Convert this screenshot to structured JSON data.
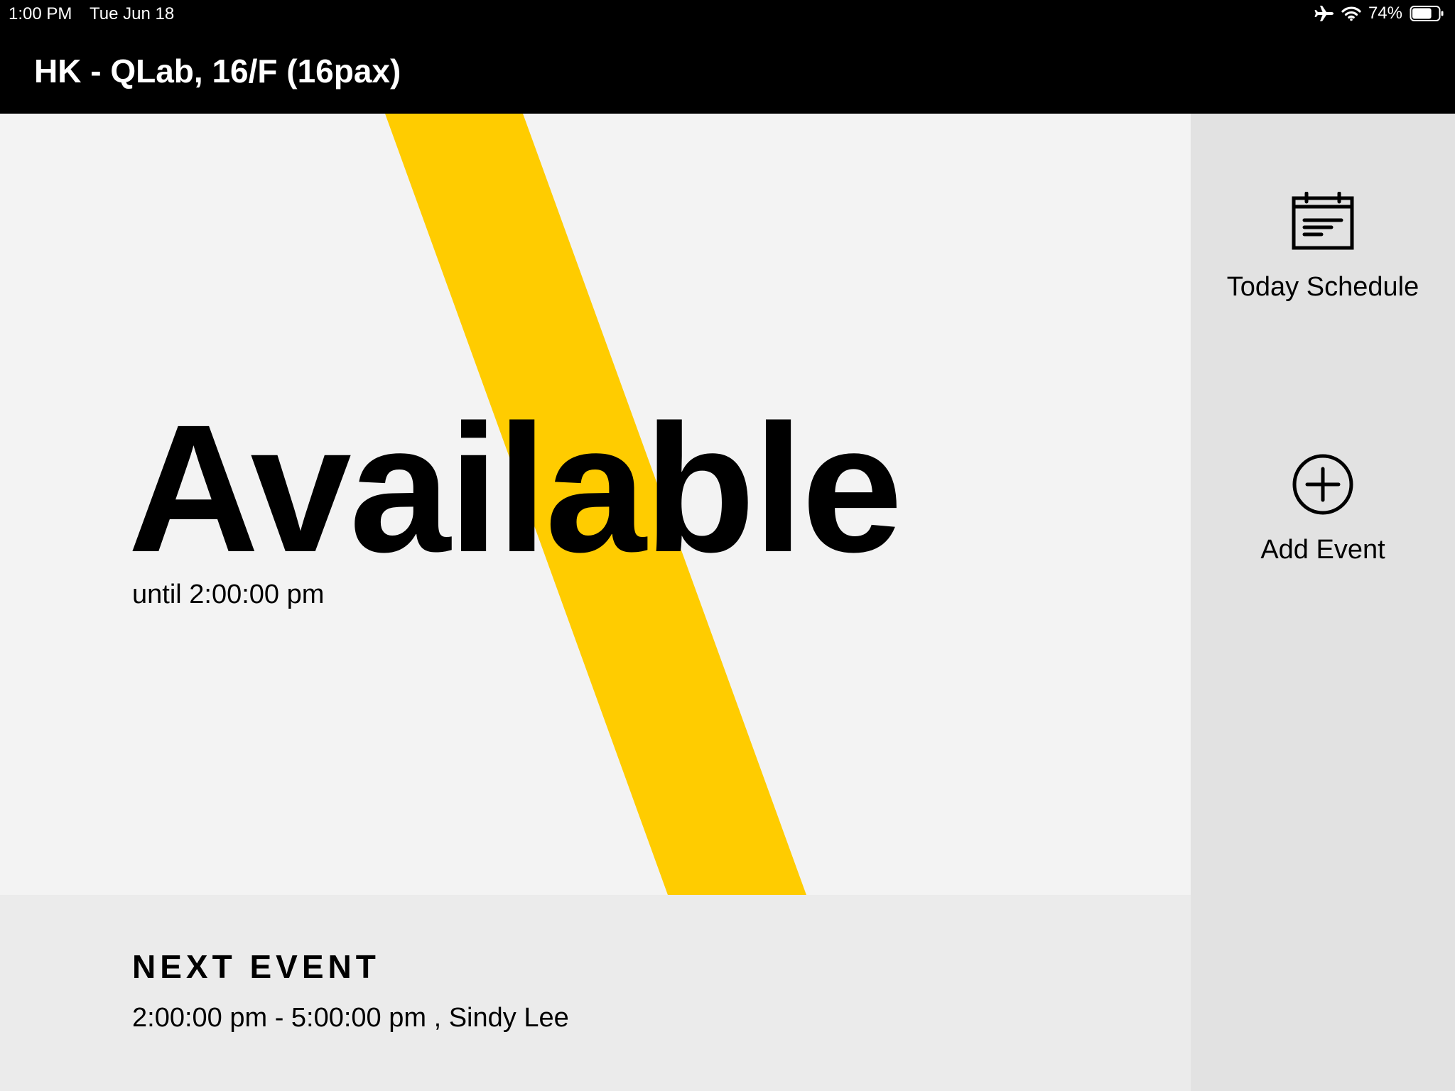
{
  "status_bar": {
    "time": "1:00 PM",
    "date": "Tue Jun 18",
    "battery_percent": "74%",
    "battery_level": 0.74,
    "icons": [
      "airplane-icon",
      "wifi-icon",
      "battery-icon"
    ]
  },
  "header": {
    "room_name": "HK - QLab, 16/F (16pax)"
  },
  "main": {
    "status": "Available",
    "until": "until 2:00:00 pm",
    "accent_color": "#ffcc00"
  },
  "next_event": {
    "heading": "NEXT EVENT",
    "detail": "2:00:00 pm - 5:00:00 pm , Sindy Lee"
  },
  "sidebar": {
    "today_schedule_label": "Today Schedule",
    "today_schedule_icon": "calendar-icon",
    "add_event_label": "Add Event",
    "add_event_icon": "plus-circle-icon"
  }
}
